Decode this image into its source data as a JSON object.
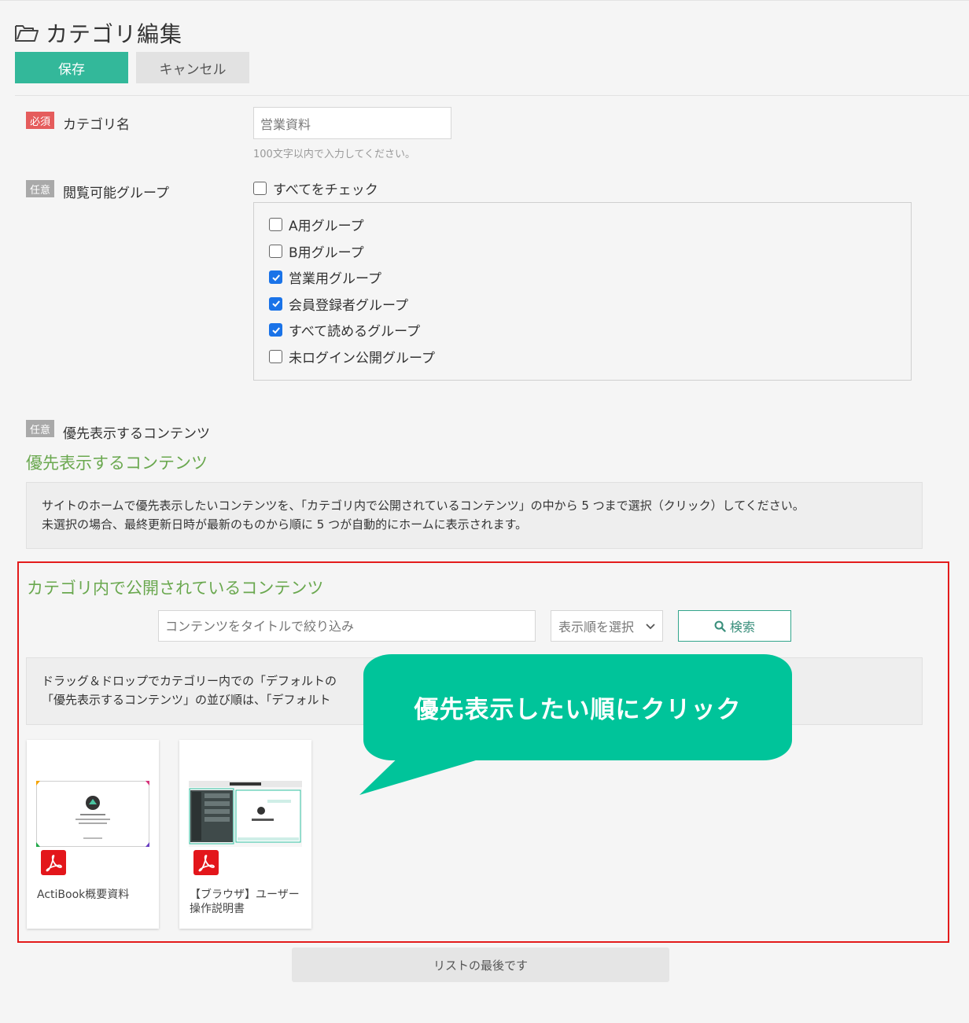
{
  "header": {
    "title": "カテゴリ編集",
    "save_label": "保存",
    "cancel_label": "キャンセル"
  },
  "category_name": {
    "badge": "必須",
    "label": "カテゴリ名",
    "value": "営業資料",
    "hint": "100文字以内で入力してください。"
  },
  "groups": {
    "badge": "任意",
    "label": "閲覧可能グループ",
    "check_all_label": "すべてをチェック",
    "check_all_checked": false,
    "items": [
      {
        "label": "A用グループ",
        "checked": false
      },
      {
        "label": "B用グループ",
        "checked": false
      },
      {
        "label": "営業用グループ",
        "checked": true
      },
      {
        "label": "会員登録者グループ",
        "checked": true
      },
      {
        "label": "すべて読めるグループ",
        "checked": true
      },
      {
        "label": "未ログイン公開グループ",
        "checked": false
      }
    ]
  },
  "priority": {
    "badge": "任意",
    "label": "優先表示するコンテンツ",
    "heading": "優先表示するコンテンツ",
    "info_line1": "サイトのホームで優先表示したいコンテンツを、「カテゴリ内で公開されているコンテンツ」の中から 5 つまで選択（クリック）してください。",
    "info_line2": "未選択の場合、最終更新日時が最新のものから順に 5 つが自動的にホームに表示されます。"
  },
  "published": {
    "heading": "カテゴリ内で公開されているコンテンツ",
    "search_placeholder": "コンテンツをタイトルで絞り込み",
    "sort_label": "表示順を選択",
    "search_button": "検索",
    "dd_line1": "ドラッグ＆ドロップでカテゴリー内での「デフォルトの",
    "dd_line2": "「優先表示するコンテンツ」の並び順は、「デフォルト",
    "cards": [
      {
        "title": "ActiBook概要資料"
      },
      {
        "title": "【ブラウザ】ユーザー操作説明書"
      }
    ],
    "end_label": "リストの最後です"
  },
  "callout": {
    "text": "優先表示したい順にクリック"
  },
  "colors": {
    "accent": "#33b89a",
    "heading_green": "#6aa84f",
    "required_red": "#e55c5c",
    "frame_red": "#e31b1b",
    "callout": "#00c49a"
  }
}
